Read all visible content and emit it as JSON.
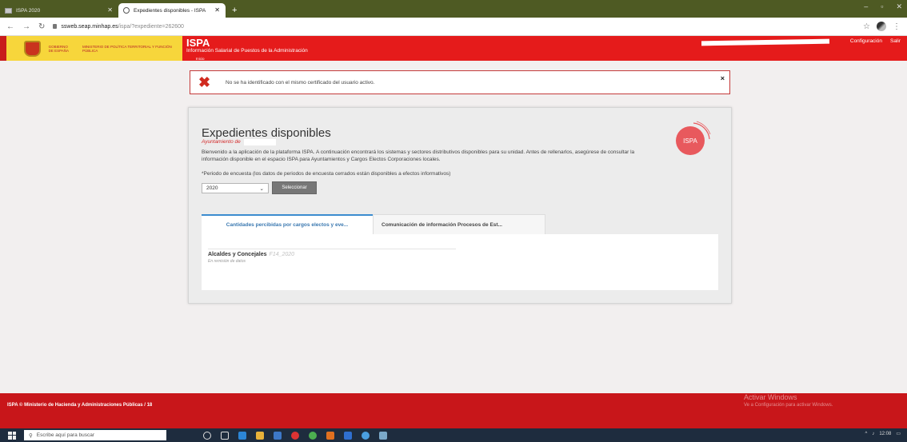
{
  "browser": {
    "tabs": [
      {
        "title": "ISPA 2020",
        "active": false
      },
      {
        "title": "Expedientes disponibles - ISPA",
        "active": true
      }
    ],
    "new_tab": "+",
    "url_host": "ssweb.seap.minhap.es",
    "url_path": "/ispa/?expediente=262600",
    "win_min": "–",
    "win_max": "▫",
    "win_close": "✕"
  },
  "header": {
    "gobierno": "GOBIERNO DE ESPAÑA",
    "ministerio": "MINISTERIO DE POLÍTICA TERRITORIAL Y FUNCIÓN PÚBLICA",
    "title": "ISPA",
    "subtitle": "Información Salarial de Puestos de la Administración",
    "inicio": "Inicio",
    "config": "Configuración",
    "logout": "Salir"
  },
  "alert": {
    "message": "No se ha identificado con el mismo certificado del usuario activo.",
    "close": "×"
  },
  "main": {
    "title": "Expedientes disponibles",
    "org": "Ayuntamiento de",
    "intro": "Bienvenido a la aplicación de la plataforma ISPA. A continuación encontrará los sistemas y sectores distributivos disponibles para su unidad. Antes de rellenarlos, asegúrese de consultar la información disponible en el espacio ISPA para Ayuntamientos y Cargos Electos Corporaciones locales.",
    "period_label": "*Periodo de encuesta (los datos de periodos de encuesta cerrados están disponibles a efectos informativos)",
    "year_value": "2020",
    "select_button": "Seleccionar",
    "logo_text": "ISPA",
    "tabs": [
      {
        "label": "Cantidades percibidas por cargos electos y eve..."
      },
      {
        "label": "Comunicación de información Procesos de Est..."
      }
    ],
    "item": {
      "title": "Alcaldes y Concejales",
      "code": "F14_2020",
      "status": "En remisión de datos"
    }
  },
  "footer": {
    "text": "ISPA © Ministerio de Hacienda y Administraciones Públicas / 18"
  },
  "windows": {
    "activate_title": "Activar Windows",
    "activate_sub": "Ve a Configuración para activar Windows.",
    "search_placeholder": "Escribe aquí para buscar",
    "time": "12:08"
  },
  "colors": {
    "brand_red": "#e51b1b",
    "footer_red": "#c8161a",
    "tab_blue": "#3b8ccf",
    "chrome_olive": "#4e5a23"
  }
}
